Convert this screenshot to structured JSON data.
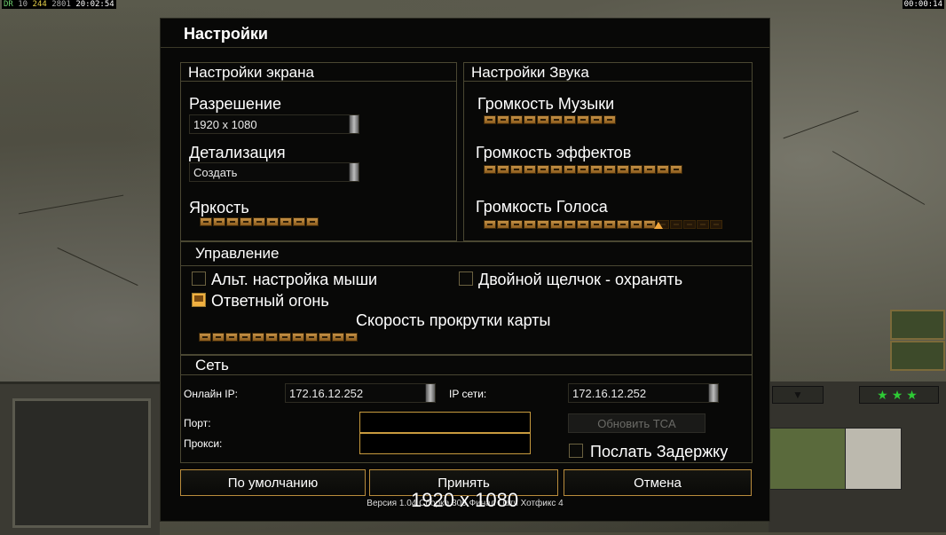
{
  "hud": {
    "topbar_left": {
      "a": "DR",
      "b": "10",
      "c": "244",
      "d": "2801",
      "time": "20:02:54"
    },
    "topbar_right": "00:00:14"
  },
  "dialog": {
    "title": "Настройки",
    "screen": {
      "header": "Настройки экрана",
      "resolution_label": "Разрешение",
      "resolution_value": "1920 x 1080",
      "detail_label": "Детализация",
      "detail_value": "Создать",
      "brightness_label": "Яркость",
      "brightness_level": 1.0
    },
    "sound": {
      "header": "Настройки Звука",
      "music_label": "Громкость Музыки",
      "music_level": 1.0,
      "effects_label": "Громкость эффектов",
      "effects_level": 1.0,
      "voice_label": "Громкость Голоса",
      "voice_level": 0.72
    },
    "control": {
      "header": "Управление",
      "alt_mouse_label": "Альт. настройка мыши",
      "alt_mouse_checked": false,
      "double_click_label": "Двойной щелчок - охранять",
      "double_click_checked": false,
      "return_fire_label": "Ответный огонь",
      "return_fire_checked": true,
      "scroll_speed_label": "Скорость прокрутки карты",
      "scroll_speed_level": 1.0
    },
    "network": {
      "header": "Сеть",
      "online_ip_label": "Онлайн IP:",
      "online_ip_value": "172.16.12.252",
      "net_ip_label": "IP сети:",
      "net_ip_value": "172.16.12.252",
      "port_label": "Порт:",
      "proxy_label": "Прокси:",
      "update_tca_label": "Обновить TCA",
      "send_delay_label": "Послать Задержку",
      "send_delay_checked": false
    },
    "buttons": {
      "default_label": "По умолчанию",
      "accept_label": "Принять",
      "cancel_label": "Отмена"
    },
    "version": "Версия 1.04 Сборка 309 Финал Патч Хотфикс 4",
    "overlay_resolution": "1920 x 1080"
  }
}
